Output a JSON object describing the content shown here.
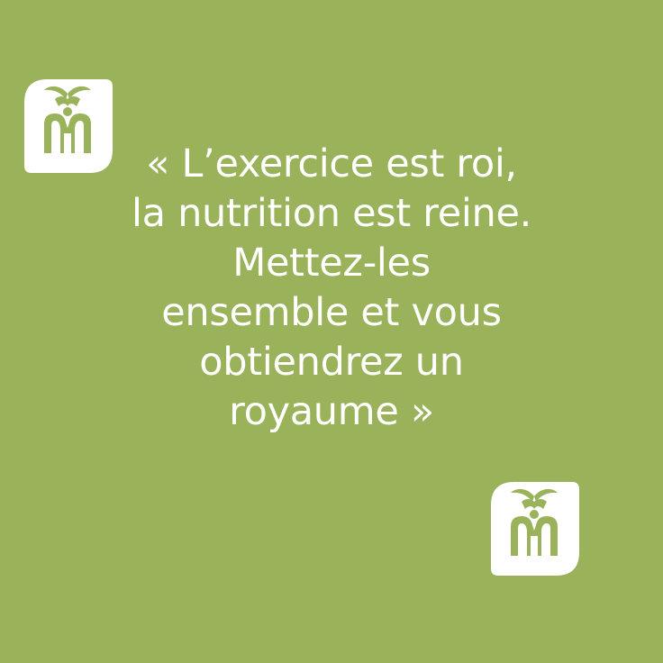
{
  "quote": {
    "lines": [
      "« L’exercice est roi,",
      "la nutrition est reine.",
      "Mettez-les",
      "ensemble et vous",
      "obtiendrez un",
      "royaume »"
    ]
  },
  "colors": {
    "background": "#9ab25a",
    "text": "#ffffff",
    "badge": "#ffffff",
    "logo": "#9ab25a"
  },
  "icons": {
    "badge": "palm-fountain-logo-icon"
  }
}
